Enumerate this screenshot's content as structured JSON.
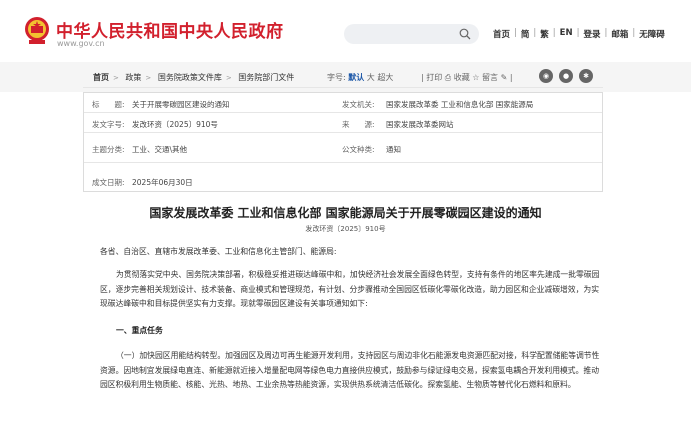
{
  "header": {
    "site_title": "中华人民共和国中央人民政府",
    "site_url": "www.gov.cn",
    "nav": [
      "首页",
      "简",
      "繁",
      "EN",
      "登录",
      "邮箱",
      "无障碍"
    ]
  },
  "toolbar": {
    "breadcrumb": [
      "首页",
      "政策",
      "国务院政策文件库",
      "国务院部门文件"
    ],
    "font_label": "字号:",
    "font_default": "默认",
    "font_large": "大",
    "font_xlarge": "超大",
    "print": "打印",
    "favorite": "收藏",
    "comment": "留言"
  },
  "info": {
    "title_label": "标　　题:",
    "title_value": "关于开展零碳园区建设的通知",
    "issuer_label": "发文机关:",
    "issuer_value": "国家发展改革委  工业和信息化部  国家能源局",
    "docno_label": "发文字号:",
    "docno_value": "发改环资〔2025〕910号",
    "source_label": "来　　源:",
    "source_value": "国家发展改革委网站",
    "topic_label": "主题分类:",
    "topic_value": "工业、交通\\其他",
    "type_label": "公文种类:",
    "type_value": "通知",
    "date_label": "成文日期:",
    "date_value": "2025年06月30日"
  },
  "document": {
    "title": "国家发展改革委  工业和信息化部  国家能源局关于开展零碳园区建设的通知",
    "doc_number": "发改环资〔2025〕910号",
    "salutation": "各省、自治区、直辖市发展改革委、工业和信息化主管部门、能源局:",
    "intro": "为贯彻落实党中央、国务院决策部署，积极稳妥推进碳达峰碳中和，加快经济社会发展全面绿色转型，支持有条件的地区率先建成一批零碳园区，逐步完善相关规划设计、技术装备、商业模式和管理规范，有计划、分步骤推动全国园区低碳化零碳化改造，助力园区和企业减碳增效，为实现碳达峰碳中和目标提供坚实有力支撑。现就零碳园区建设有关事项通知如下:",
    "section1": "一、重点任务",
    "task1": "（一）加快园区用能结构转型。加强园区及周边可再生能源开发利用，支持园区与周边非化石能源发电资源匹配对接，科学配置储能等调节性资源。因地制宜发展绿电直连、新能源就近接入增量配电网等绿色电力直接供应模式，鼓励参与绿证绿电交易，探索氢电耦合开发利用模式。推动园区积极利用生物质能、核能、光热、地热、工业余热等热能资源，实现供热系统清洁低碳化。探索氢能、生物质等替代化石燃料和原料。"
  }
}
